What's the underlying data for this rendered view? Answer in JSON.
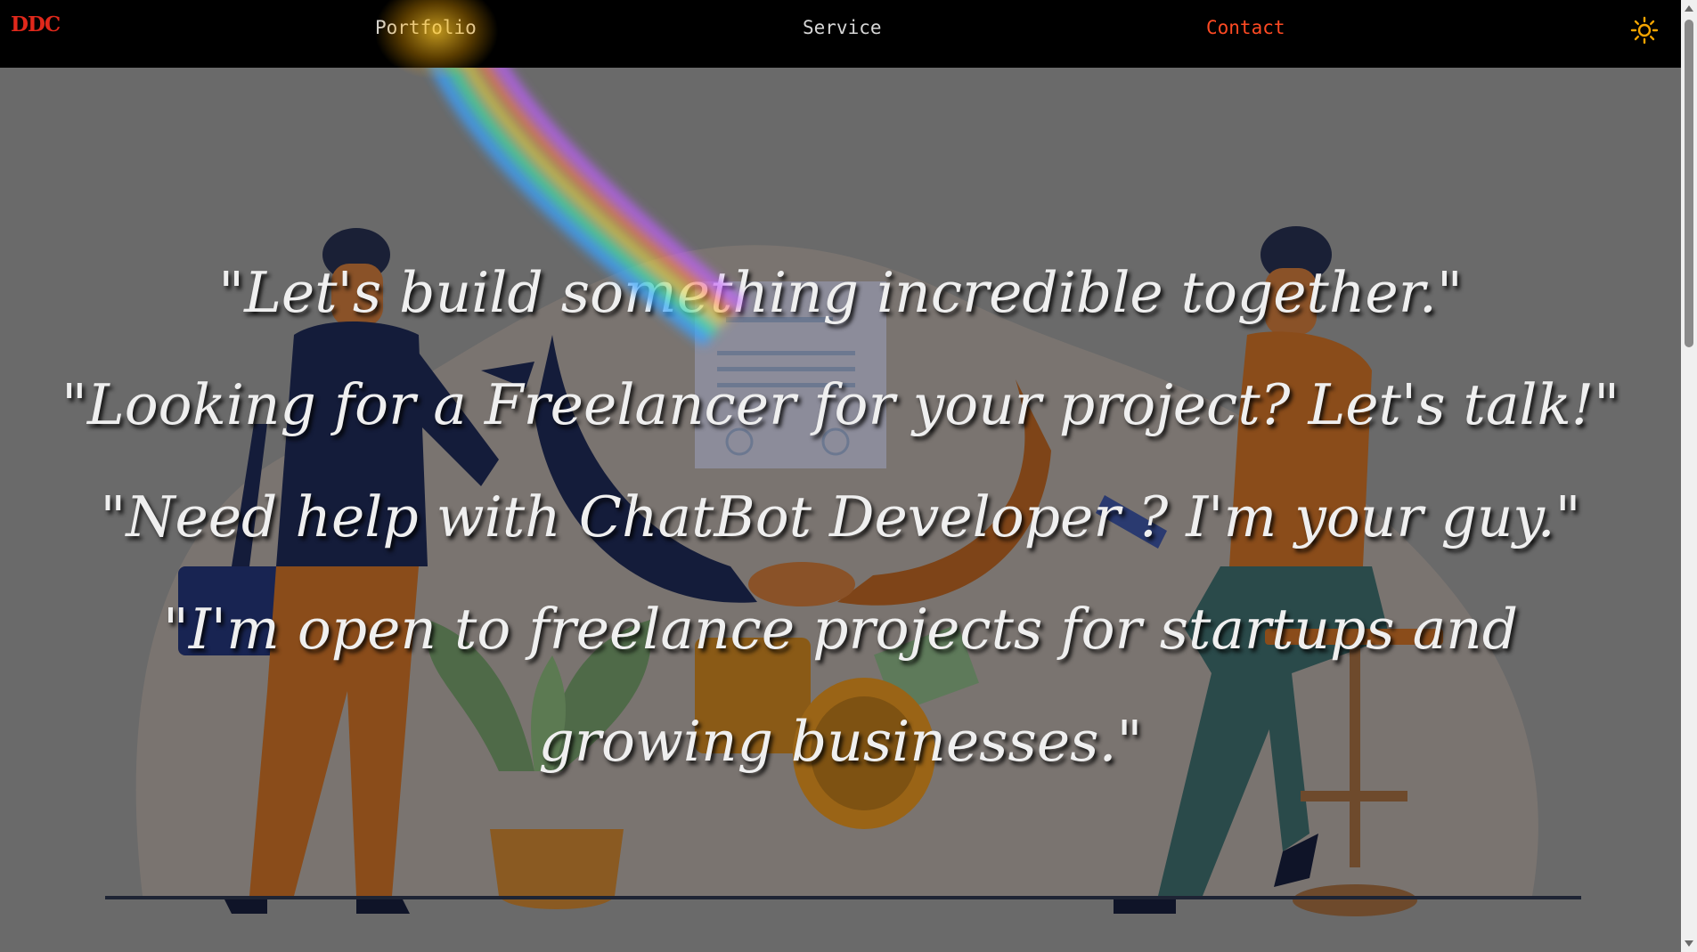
{
  "navbar": {
    "logo": "DDC",
    "links": [
      "Portfolio",
      "Service",
      "Contact"
    ],
    "active_link_color": "#ff4a23",
    "theme_toggle_icon": "sun-icon"
  },
  "hero": {
    "quotes": [
      "\"Let's build something incredible together.\"",
      "\"Looking for a Freelancer for your project? Let's talk!\"",
      "\"Need help with  ChatBot Developer ? I'm your guy.\"",
      "\"I'm open to freelance projects for startups and growing businesses.\""
    ],
    "illustration": "business-handshake-illustration"
  },
  "colors": {
    "navbar_bg": "#000000",
    "logo": "#e0281b",
    "nav_text": "#d6d6d6",
    "hero_overlay": "#6a6a6a",
    "quote_text": "#efefef"
  }
}
